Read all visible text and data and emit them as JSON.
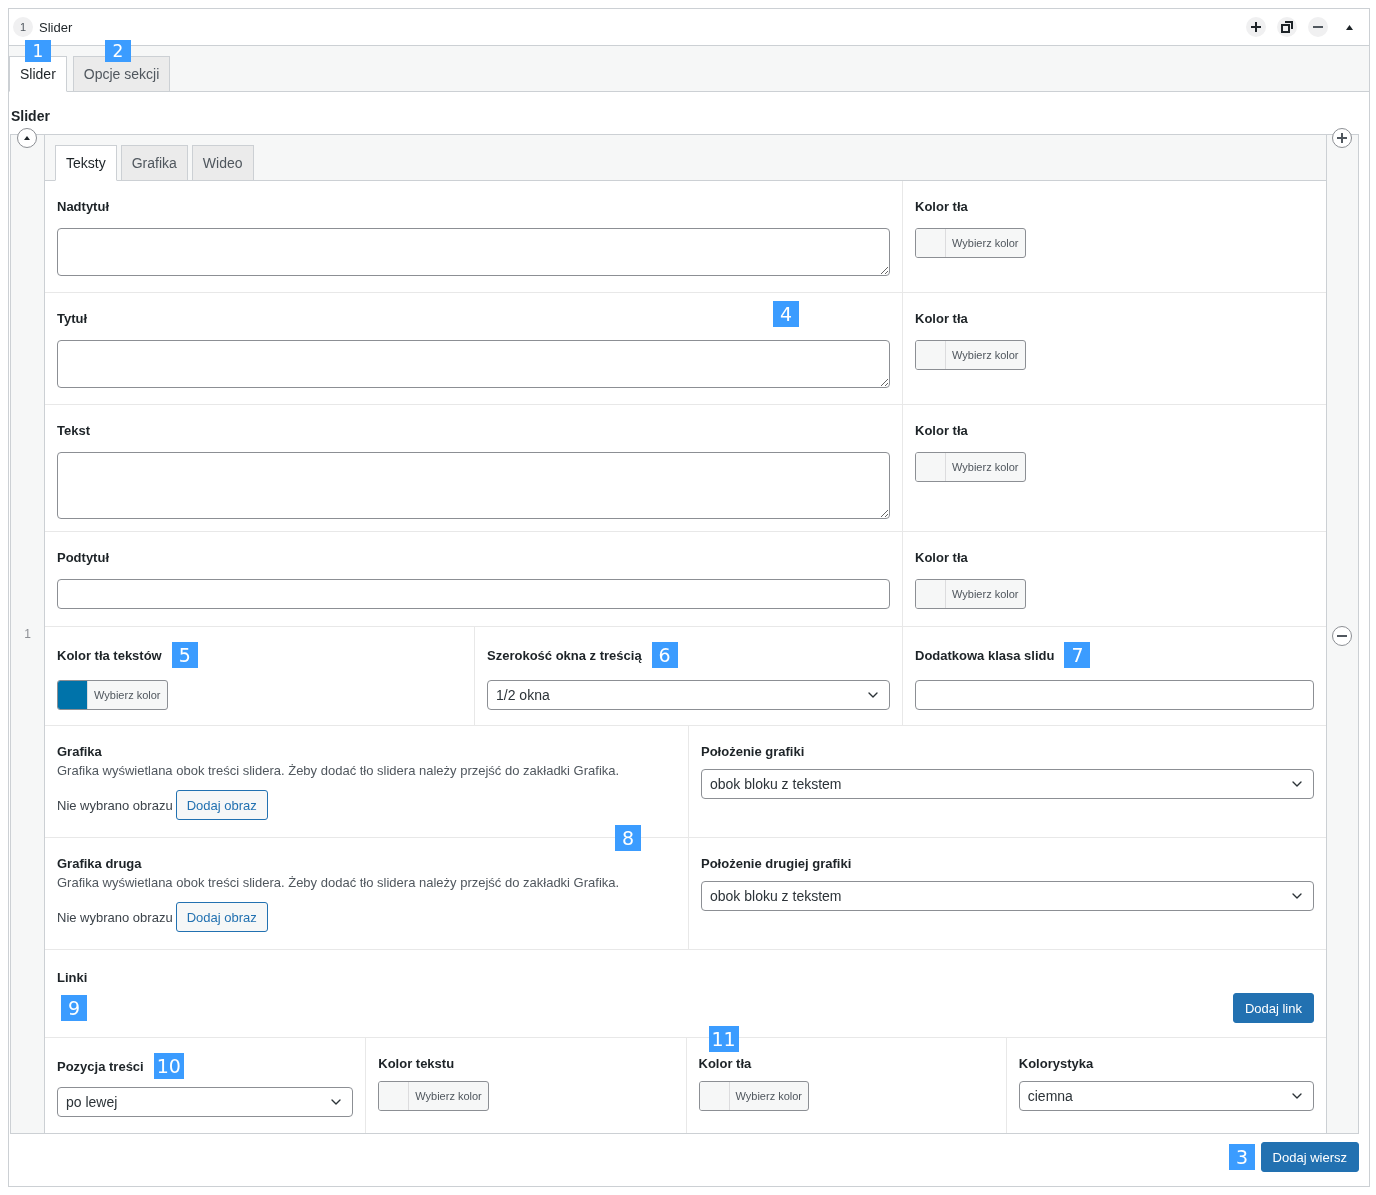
{
  "header": {
    "number": "1",
    "title": "Slider",
    "markers": [
      "1",
      "2"
    ]
  },
  "tabs": [
    {
      "label": "Slider",
      "selected": true
    },
    {
      "label": "Opcje sekcji",
      "selected": false
    }
  ],
  "section_label": "Slider",
  "row_number": "1",
  "inner_tabs": [
    {
      "label": "Teksty",
      "selected": true
    },
    {
      "label": "Grafika",
      "selected": false
    },
    {
      "label": "Wideo",
      "selected": false
    }
  ],
  "text_fields": [
    {
      "label": "Nadtytuł",
      "kind": "textarea",
      "color_label": "Kolor tła",
      "color_button": "Wybierz kolor"
    },
    {
      "label": "Tytuł",
      "kind": "textarea",
      "marker": "4",
      "color_label": "Kolor tła",
      "color_button": "Wybierz kolor"
    },
    {
      "label": "Tekst",
      "kind": "tall",
      "color_label": "Kolor tła",
      "color_button": "Wybierz kolor"
    },
    {
      "label": "Podtytuł",
      "kind": "input",
      "color_label": "Kolor tła",
      "color_button": "Wybierz kolor"
    }
  ],
  "settings": [
    {
      "label": "Kolor tła tekstów",
      "marker": "5",
      "kind": "color",
      "button": "Wybierz kolor",
      "color": "#0073aa"
    },
    {
      "label": "Szerokość okna z treścią",
      "marker": "6",
      "kind": "select",
      "value": "1/2 okna"
    },
    {
      "label": "Dodatkowa klasa slidu",
      "marker": "7",
      "kind": "input"
    }
  ],
  "images_marker": "8",
  "images": [
    {
      "label": "Grafika",
      "description": "Grafika wyświetlana obok treści slidera. Żeby dodać tło slidera należy przejść do zakładki Grafika.",
      "status": "Nie wybrano obrazu",
      "button": "Dodaj obraz",
      "position_label": "Położenie grafiki",
      "position_value": "obok bloku z tekstem"
    },
    {
      "label": "Grafika druga",
      "description": "Grafika wyświetlana obok treści slidera. Żeby dodać tło slidera należy przejść do zakładki Grafika.",
      "status": "Nie wybrano obrazu",
      "button": "Dodaj obraz",
      "position_label": "Położenie drugiej grafiki",
      "position_value": "obok bloku z tekstem"
    }
  ],
  "links": {
    "label": "Linki",
    "marker": "9",
    "button": "Dodaj link"
  },
  "bottom": [
    {
      "label": "Pozycja treści",
      "marker": "10",
      "kind": "select",
      "value": "po lewej"
    },
    {
      "label": "Kolor tekstu",
      "kind": "color",
      "button": "Wybierz kolor"
    },
    {
      "label": "Kolor tła",
      "marker": "11",
      "kind": "color",
      "button": "Wybierz kolor"
    },
    {
      "label": "Kolorystyka",
      "kind": "select",
      "value": "ciemna"
    }
  ],
  "footer": {
    "marker": "3",
    "button": "Dodaj wiersz"
  }
}
